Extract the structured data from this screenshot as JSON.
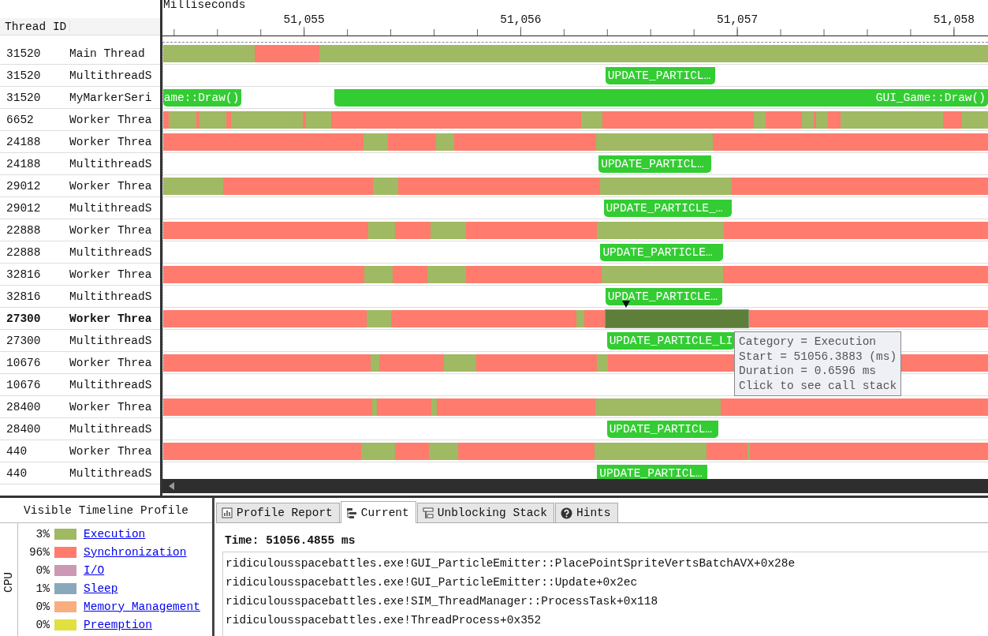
{
  "timeline": {
    "axis_title": "Milliseconds",
    "ticks": [
      "51,055",
      "51,056",
      "51,057",
      "51,058"
    ]
  },
  "thread_header": "Thread ID",
  "threads": [
    {
      "id": "31520",
      "name": "Main Thread",
      "selected": false
    },
    {
      "id": "31520",
      "name": "MultithreadS",
      "selected": false,
      "markers": [
        "UPDATE_PARTICL…"
      ]
    },
    {
      "id": "31520",
      "name": "MyMarkerSeri",
      "selected": false,
      "markers": [
        "ame::Draw()",
        "GUI_Game::Draw()"
      ]
    },
    {
      "id": "6652",
      "name": "Worker Threa",
      "selected": false
    },
    {
      "id": "24188",
      "name": "Worker Threa",
      "selected": false
    },
    {
      "id": "24188",
      "name": "MultithreadS",
      "selected": false,
      "markers": [
        "UPDATE_PARTICL…"
      ]
    },
    {
      "id": "29012",
      "name": "Worker Threa",
      "selected": false
    },
    {
      "id": "29012",
      "name": "MultithreadS",
      "selected": false,
      "markers": [
        "UPDATE_PARTICLE_…"
      ]
    },
    {
      "id": "22888",
      "name": "Worker Threa",
      "selected": false
    },
    {
      "id": "22888",
      "name": "MultithreadS",
      "selected": false,
      "markers": [
        "UPDATE_PARTICLE…"
      ]
    },
    {
      "id": "32816",
      "name": "Worker Threa",
      "selected": false
    },
    {
      "id": "32816",
      "name": "MultithreadS",
      "selected": false,
      "markers": [
        "UPDATE_PARTICLE…"
      ]
    },
    {
      "id": "27300",
      "name": "Worker Threa",
      "selected": true
    },
    {
      "id": "27300",
      "name": "MultithreadS",
      "selected": false,
      "markers": [
        "UPDATE_PARTICLE_LI"
      ]
    },
    {
      "id": "10676",
      "name": "Worker Threa",
      "selected": false
    },
    {
      "id": "10676",
      "name": "MultithreadS",
      "selected": false
    },
    {
      "id": "28400",
      "name": "Worker Threa",
      "selected": false
    },
    {
      "id": "28400",
      "name": "MultithreadS",
      "selected": false,
      "markers": [
        "UPDATE_PARTICL…"
      ]
    },
    {
      "id": "440",
      "name": "Worker Threa",
      "selected": false
    },
    {
      "id": "440",
      "name": "MultithreadS",
      "selected": false,
      "markers": [
        "UPDATE_PARTICL…"
      ]
    }
  ],
  "tooltip": {
    "lines": [
      "Category = Execution",
      "Start = 51056.3883 (ms)",
      "Duration = 0.6596 ms",
      "Click to see call stack"
    ]
  },
  "legend": {
    "title": "Visible Timeline Profile",
    "group": "CPU",
    "items": [
      {
        "percent": "3%",
        "label": "Execution",
        "color": "#a0b963"
      },
      {
        "percent": "96%",
        "label": "Synchronization",
        "color": "#ff7b6e"
      },
      {
        "percent": "0%",
        "label": "I/O",
        "color": "#cc99b5"
      },
      {
        "percent": "1%",
        "label": "Sleep",
        "color": "#8aa8bb"
      },
      {
        "percent": "0%",
        "label": "Memory Management",
        "color": "#f8ae7f"
      },
      {
        "percent": "0%",
        "label": "Preemption",
        "color": "#e0e040"
      }
    ]
  },
  "tabs": [
    {
      "label": "Profile Report",
      "kind": "report",
      "selected": false
    },
    {
      "label": "Current",
      "kind": "tree",
      "selected": true
    },
    {
      "label": "Unblocking Stack",
      "kind": "stack",
      "selected": false
    },
    {
      "label": "Hints",
      "kind": "help",
      "selected": false
    }
  ],
  "current": {
    "time": "Time: 51056.4855 ms",
    "stack": [
      "ridiculousspacebattles.exe!GUI_ParticleEmitter::PlacePointSpriteVertsBatchAVX+0x28e",
      "ridiculousspacebattles.exe!GUI_ParticleEmitter::Update+0x2ec",
      "ridiculousspacebattles.exe!SIM_ThreadManager::ProcessTask+0x118",
      "ridiculousspacebattles.exe!ThreadProcess+0x352"
    ]
  }
}
